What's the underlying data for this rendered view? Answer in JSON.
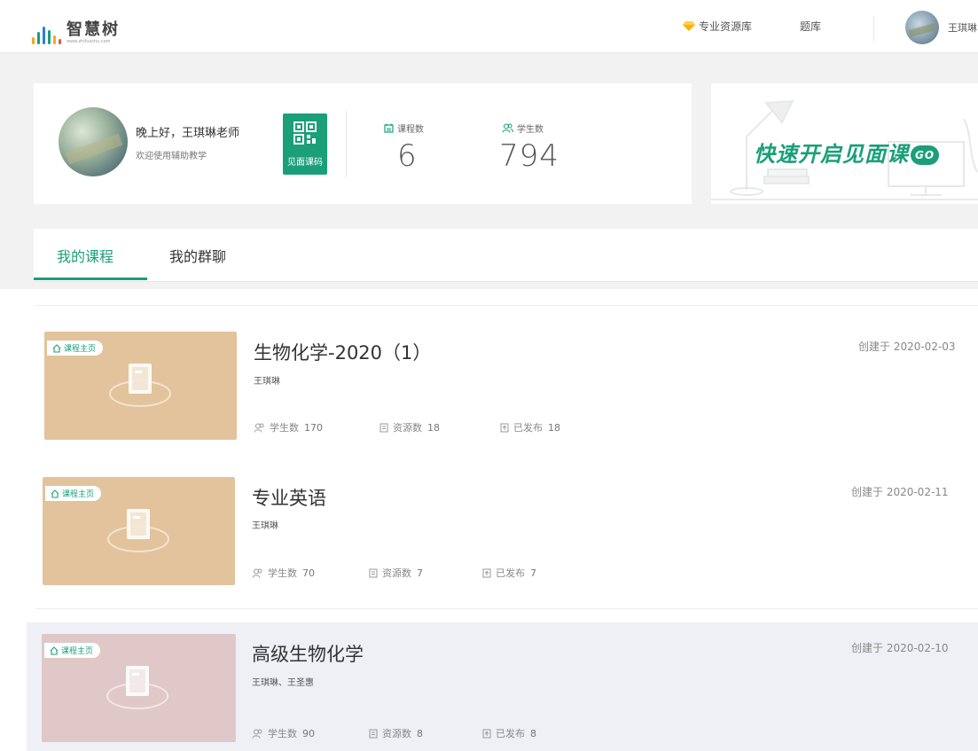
{
  "header": {
    "logo_name": "智慧树",
    "logo_url": "www.zhihuishu.com",
    "nav": {
      "resource_label": "专业资源库",
      "bank_label": "题库"
    },
    "user_name": "王琪琳"
  },
  "profile": {
    "greeting": "晚上好，王琪琳老师",
    "welcome": "欢迎使用辅助教学",
    "qr_label": "见面课码",
    "stats": {
      "courses_label": "课程数",
      "courses_value": "6",
      "students_label": "学生数",
      "students_value": "794"
    }
  },
  "banner": {
    "text": "快速开启见面课",
    "go": "GO"
  },
  "tabs": [
    {
      "label": "我的课程",
      "active": true
    },
    {
      "label": "我的群聊",
      "active": false
    }
  ],
  "course_labels": {
    "tag": "课程主页",
    "students": "学生数",
    "resources": "资源数",
    "published": "已发布"
  },
  "courses": [
    {
      "title": "生物化学-2020（1）",
      "teacher": "王琪琳",
      "students": "170",
      "resources": "18",
      "published": "18",
      "created": "创建于 2020-02-03",
      "cover_color": "#e2c39c"
    },
    {
      "title": "专业英语",
      "teacher": "王琪琳",
      "students": "70",
      "resources": "7",
      "published": "7",
      "created": "创建于 2020-02-11",
      "cover_color": "#e2c39c"
    },
    {
      "title": "高级生物化学",
      "teacher": "王琪琳、王圣惠",
      "students": "90",
      "resources": "8",
      "published": "8",
      "created": "创建于 2020-02-10",
      "cover_color": "#e1c8c8"
    }
  ],
  "colors": {
    "accent": "#1a9f79",
    "highlight_row": "#eef0f6"
  }
}
